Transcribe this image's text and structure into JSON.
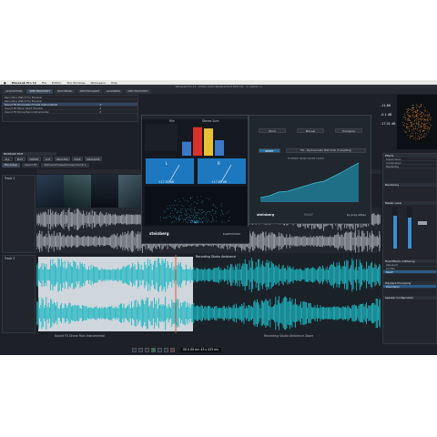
{
  "menubar": {
    "app_name": "WaveLab Pro 11",
    "items": [
      "File",
      "Edition",
      "Tool Windows",
      "Workspace",
      "Help"
    ]
  },
  "window": {
    "title": "WaveLab Pro 11 - [Video Audio Replacement EDIT.mlr - 2 / Users/...]"
  },
  "tabs": [
    {
      "label": "ACQUISITION"
    },
    {
      "label": "SPECTRUM EDIT",
      "active": true
    },
    {
      "label": "MASTERING"
    },
    {
      "label": "SPECTROGRAM"
    },
    {
      "label": "LOUDNESS"
    },
    {
      "label": "SPECTRUM EDIT"
    }
  ],
  "file_browser": {
    "rows": [
      {
        "label": "Recording Watch For Explorer",
        "value": ""
      },
      {
        "label": "Recording Watch For Explorer",
        "value": ""
      },
      {
        "label": "Sound FX Drone Rain Forest Instrumental",
        "value": "1"
      },
      {
        "label": "Sound FX Music Sport Shooter",
        "value": "2"
      },
      {
        "label": "Sound FX Drone Rain Instrumental",
        "value": "3"
      }
    ]
  },
  "supervision": {
    "brand": "steinberg",
    "product": "supervision",
    "meter_labels": [
      "L",
      "R"
    ],
    "readouts": [
      "+17.93 dB",
      "+17.85 dB"
    ],
    "level_header": [
      "Min",
      "Stereo Sum"
    ],
    "bars": [
      {
        "color": "#3a78c8",
        "value": 0.45
      },
      {
        "color": "#d9322a",
        "value": 0.92
      },
      {
        "color": "#e6c132",
        "value": 0.88
      },
      {
        "color": "#3a78c8",
        "value": 0.5
      }
    ]
  },
  "maat": {
    "brand": "steinberg",
    "product": "MAAT",
    "partner": "by prog.dither",
    "buttons": [
      "Pinch",
      "Manual",
      "Triangular"
    ],
    "mode_label": "RESET",
    "preset": "FS1 - Psychoacoustic Multi Order (F-weighting)",
    "chart_caption": "FILTERED NOISE SHAPE CURVE"
  },
  "right_panel": {
    "level_readouts": [
      "-11.88",
      "-0.1 dB",
      "-17.01 dB"
    ],
    "sections": [
      {
        "label": "Effects",
        "rows": [
          "Supervision",
          "Compressor",
          "MasterRig"
        ]
      },
      {
        "label": "Monitoring",
        "rows": []
      },
      {
        "label": "Master Level",
        "rows": []
      },
      {
        "label": "Final Effects / Dithering",
        "rows": [
          "Standard",
          "Limiter",
          "MAAT"
        ]
      },
      {
        "label": "Playback Processing",
        "rows": [
          "Resampler"
        ]
      },
      {
        "label": "Speaker Configuration",
        "rows": []
      }
    ]
  },
  "montage": {
    "section_label": "MONTAGE EDIT",
    "toolbar": [
      "ALL",
      "EDIT",
      "INSERT",
      "CUT",
      "PROCESS",
      "FADE",
      "ENVELOPE"
    ],
    "track_tabs": [
      "File Group",
      "Sound FX",
      "Trimmed Forward Crowd (Vol 2) L"
    ],
    "tracks": [
      {
        "name": "Track 1",
        "color": "#7d838b"
      },
      {
        "name": "Track 2",
        "color": "#1fb7c2"
      }
    ],
    "clip_labels": [
      "Recording Studio Ambience",
      "Sound FX Drone Rain Instrumental",
      "Recording Studio Ambience Zoom"
    ]
  },
  "transport": {
    "time": "00 h 00 mn 43 s 433 ms"
  },
  "colors": {
    "accent": "#1fb7c2",
    "playhead": "#e3572a",
    "wave_gray": "#9ca2a9"
  }
}
